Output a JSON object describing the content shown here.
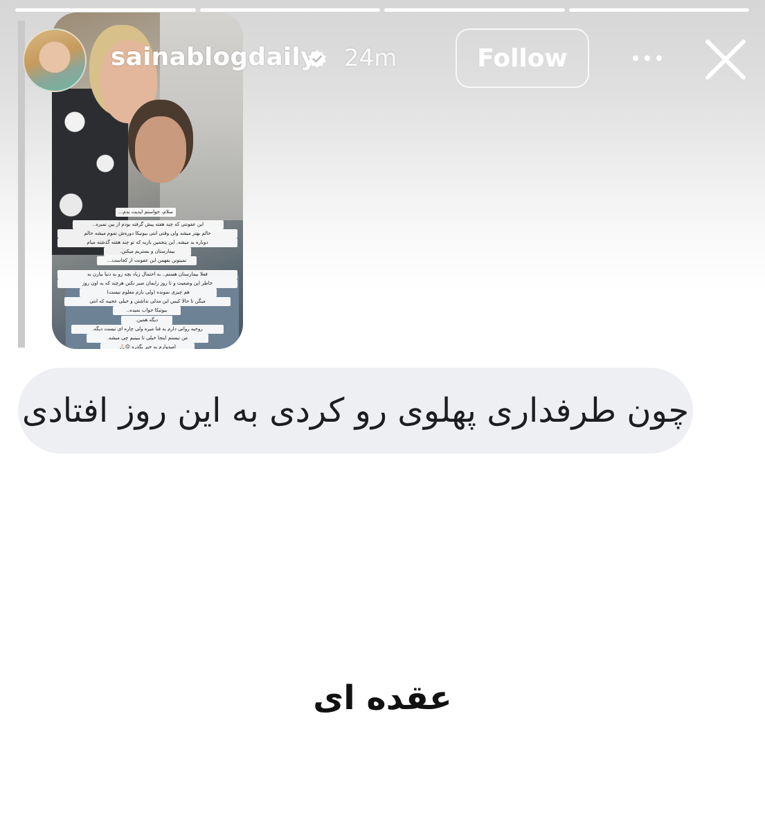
{
  "story": {
    "progress_segments": [
      {
        "fill": 1.0
      },
      {
        "fill": 1.0
      },
      {
        "fill": 1.0
      },
      {
        "fill": 1.0
      }
    ]
  },
  "header": {
    "username": "sainablogdaily",
    "verified": true,
    "time": "24m",
    "follow_label": "Follow",
    "more_icon": "more-horizontal-icon",
    "close_icon": "close-icon"
  },
  "quoted_story": {
    "text_lines": [
      "سلام، خواستم اپدیت بدم...",
      "این عفونتی که چند هفته پیش گرفته بودم از بین نمیره..",
      "حالم بهتر میشه ولی وقتی انتی بیوتیکا دوره‌ش تموم میشه حالم",
      "دوباره بد میشه. این پنجمین باریه که تو چند هفته گذشته میام",
      "بیمارستان و بستریم میکنن.",
      "نمیتونن بفهمن این عفونت از کجاست...",
      "فعلا بیمارستان هستم.. به احتمال زیاد بچه رو به دنیا بیارن به",
      "خاطر این وضعیت و تا روز زایمان صبر نکنن هرچند که به اون روز",
      "هم چیزی نمونده (ولی بازم معلوم نیست)",
      "میگن تا حالا کیس این مدلی نداشتن و خیلی عجیبه که انتی",
      "بیوتیکا جواب نمیده..",
      "دیگه همین.",
      "روحیه روانی دارم به فنا میره ولی چاره ای نیست دیگه.",
      "من نیستم اینجا خیلی تا ببینیم چی میشه.",
      "امیدوارم به خیر بگذره 😔🙏🏻"
    ]
  },
  "reply": {
    "text": "چون طرفداری پهلوی رو کردی به این روز افتادی"
  },
  "caption": {
    "text": "عقده ای"
  }
}
